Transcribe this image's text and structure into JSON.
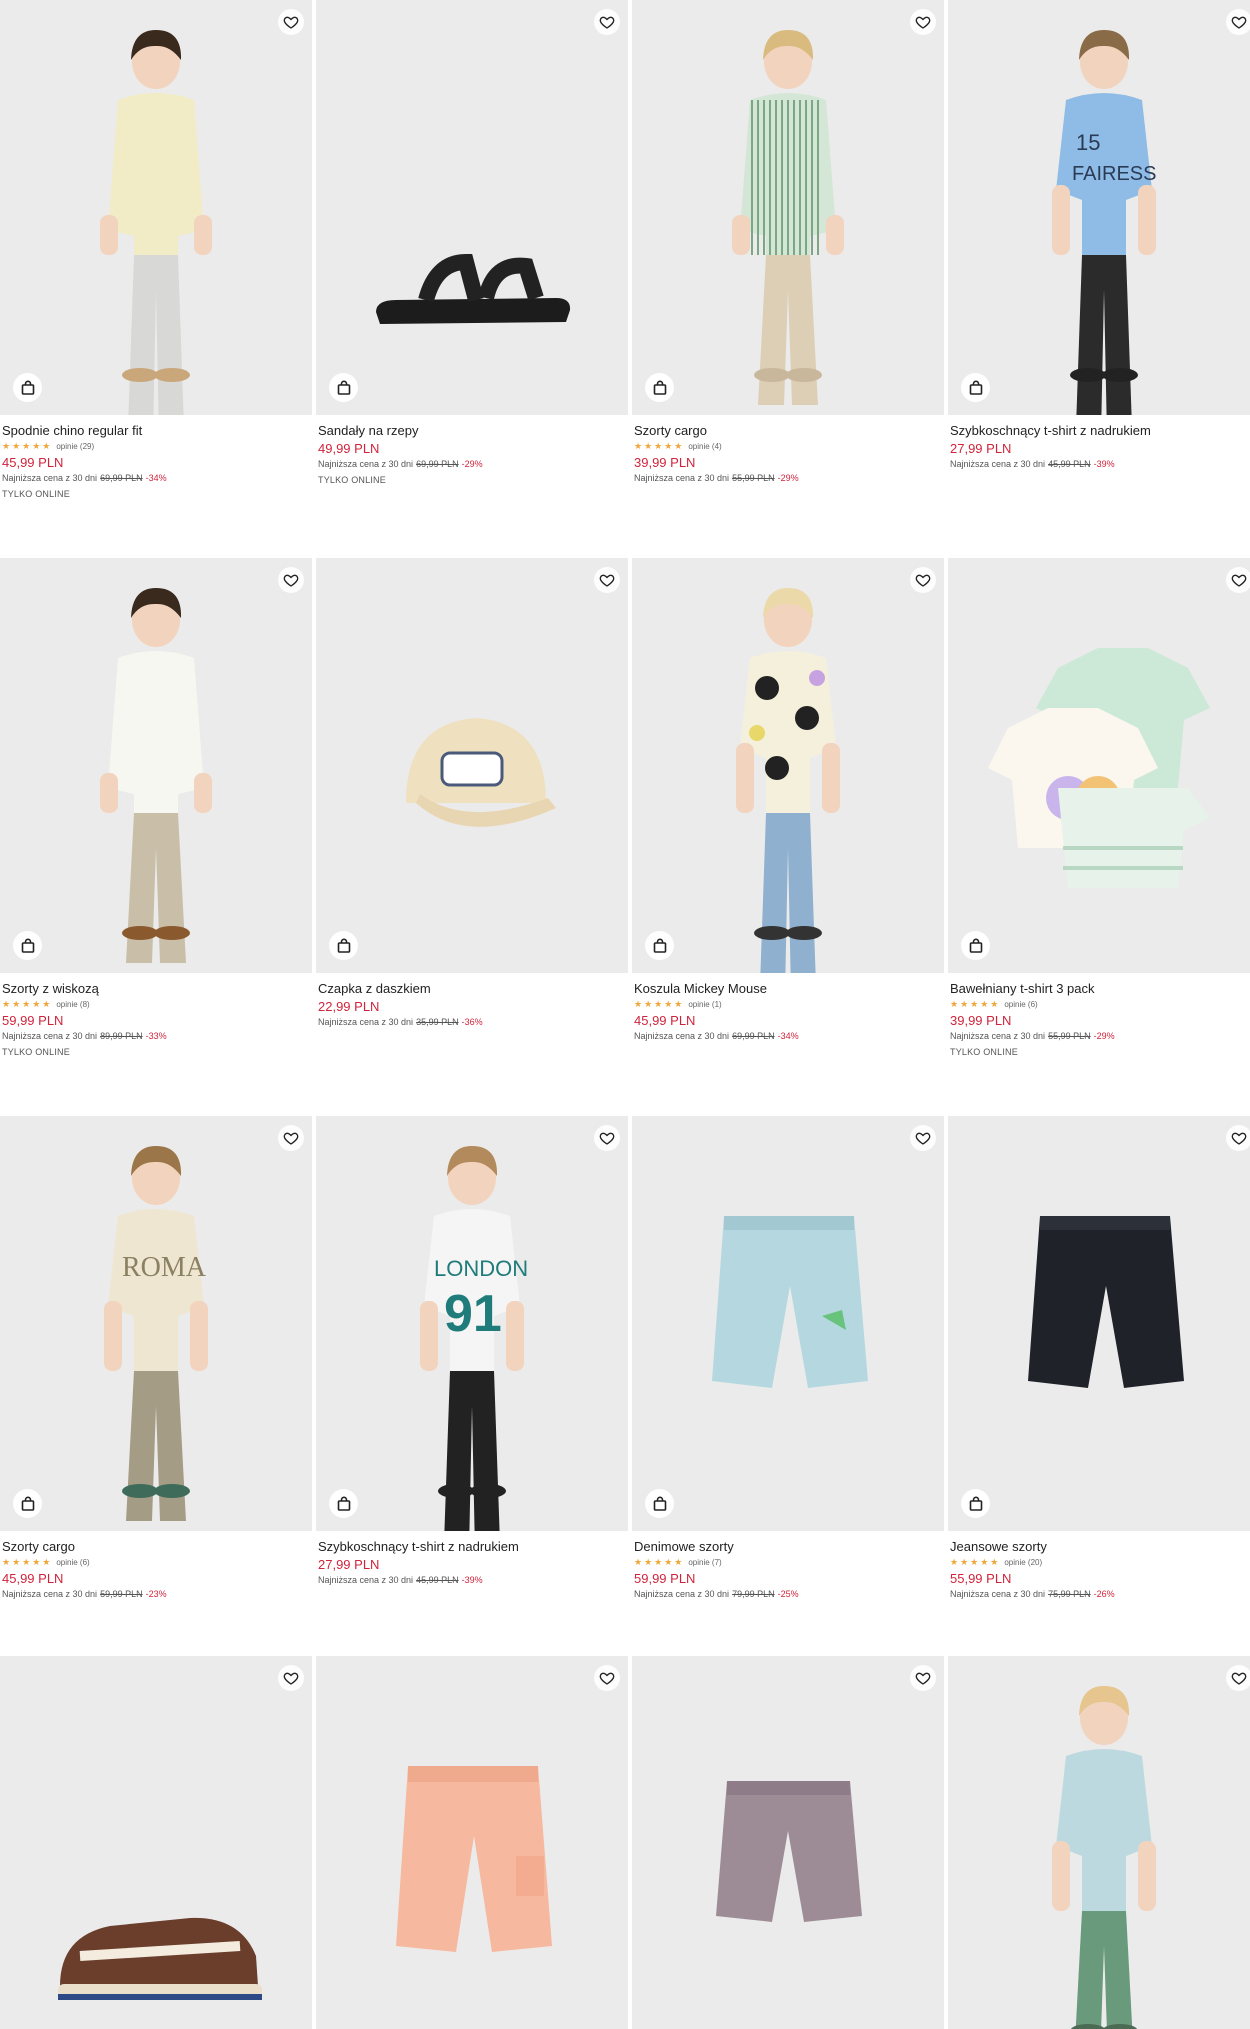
{
  "products": [
    {
      "name": "Spodnie chino regular fit",
      "stars": "★★★★★",
      "reviews": "opinie (29)",
      "price": "45,99 PLN",
      "lowest_label": "Najniższa cena z 30 dni",
      "old_price": "69,99 PLN",
      "discount": "-34%",
      "badge": "TYLKO ONLINE",
      "art": "kid-chino"
    },
    {
      "name": "Sandały na rzepy",
      "stars": "",
      "reviews": "",
      "price": "49,99 PLN",
      "lowest_label": "Najniższa cena z 30 dni",
      "old_price": "69,99 PLN",
      "discount": "-29%",
      "badge": "TYLKO ONLINE",
      "art": "sandal"
    },
    {
      "name": "Szorty cargo",
      "stars": "★★★★★",
      "reviews": "opinie (4)",
      "price": "39,99 PLN",
      "lowest_label": "Najniższa cena z 30 dni",
      "old_price": "55,99 PLN",
      "discount": "-29%",
      "badge": "",
      "art": "kid-stripe"
    },
    {
      "name": "Szybkoschnący t-shirt z nadrukiem",
      "stars": "",
      "reviews": "",
      "price": "27,99 PLN",
      "lowest_label": "Najniższa cena z 30 dni",
      "old_price": "45,99 PLN",
      "discount": "-39%",
      "badge": "",
      "art": "kid-blue"
    },
    {
      "name": "Szorty z wiskozą",
      "stars": "★★★★★",
      "reviews": "opinie (8)",
      "price": "59,99 PLN",
      "lowest_label": "Najniższa cena z 30 dni",
      "old_price": "89,99 PLN",
      "discount": "-33%",
      "badge": "TYLKO ONLINE",
      "art": "kid-white"
    },
    {
      "name": "Czapka z daszkiem",
      "stars": "",
      "reviews": "",
      "price": "22,99 PLN",
      "lowest_label": "Najniższa cena z 30 dni",
      "old_price": "35,99 PLN",
      "discount": "-36%",
      "badge": "",
      "art": "cap"
    },
    {
      "name": "Koszula Mickey Mouse",
      "stars": "★★★★★",
      "reviews": "opinie (1)",
      "price": "45,99 PLN",
      "lowest_label": "Najniższa cena z 30 dni",
      "old_price": "69,99 PLN",
      "discount": "-34%",
      "badge": "",
      "art": "kid-mickey"
    },
    {
      "name": "Bawełniany t-shirt 3 pack",
      "stars": "★★★★★",
      "reviews": "opinie (6)",
      "price": "39,99 PLN",
      "lowest_label": "Najniższa cena z 30 dni",
      "old_price": "55,99 PLN",
      "discount": "-29%",
      "badge": "TYLKO ONLINE",
      "art": "tshirts"
    },
    {
      "name": "Szorty cargo",
      "stars": "★★★★★",
      "reviews": "opinie (6)",
      "price": "45,99 PLN",
      "lowest_label": "Najniższa cena z 30 dni",
      "old_price": "59,99 PLN",
      "discount": "-23%",
      "badge": "",
      "art": "kid-roma"
    },
    {
      "name": "Szybkoschnący t-shirt z nadrukiem",
      "stars": "",
      "reviews": "",
      "price": "27,99 PLN",
      "lowest_label": "Najniższa cena z 30 dni",
      "old_price": "45,99 PLN",
      "discount": "-39%",
      "badge": "",
      "art": "kid-london"
    },
    {
      "name": "Denimowe szorty",
      "stars": "★★★★★",
      "reviews": "opinie (7)",
      "price": "59,99 PLN",
      "lowest_label": "Najniższa cena z 30 dni",
      "old_price": "79,99 PLN",
      "discount": "-25%",
      "badge": "",
      "art": "denim-light"
    },
    {
      "name": "Jeansowe szorty",
      "stars": "★★★★★",
      "reviews": "opinie (20)",
      "price": "55,99 PLN",
      "lowest_label": "Najniższa cena z 30 dni",
      "old_price": "75,99 PLN",
      "discount": "-26%",
      "badge": "",
      "art": "denim-dark"
    },
    {
      "name": "",
      "art": "sneaker"
    },
    {
      "name": "",
      "art": "shorts-peach"
    },
    {
      "name": "",
      "art": "shorts-mauve"
    },
    {
      "name": "",
      "art": "kid-toddler"
    }
  ],
  "colors": {
    "price": "#d0243c",
    "stars": "#f0a63a",
    "photo_bg": "#ebebeb"
  },
  "icons": {
    "wishlist": "heart-icon",
    "add_to_cart": "shopping-bag-icon"
  }
}
